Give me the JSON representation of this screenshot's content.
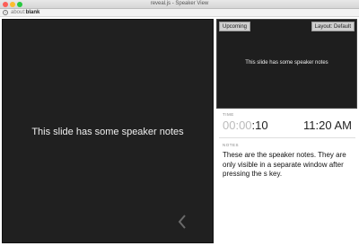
{
  "window": {
    "title": "reveal.js - Speaker View"
  },
  "urlbar": {
    "url_prefix": "about:",
    "url_strong": "blank"
  },
  "current_slide": {
    "text": "This slide has some speaker notes"
  },
  "upcoming": {
    "label": "Upcoming",
    "layout_label": "Layout: Default",
    "text": "This slide has some speaker notes"
  },
  "time": {
    "label": "TIME",
    "elapsed_dim": "00:00",
    "elapsed_main": ":10",
    "clock": "11:20 AM"
  },
  "notes": {
    "label": "NOTES",
    "text": "These are the speaker notes. They are only visible in a separate window after pressing the s key."
  },
  "colors": {
    "slide_bg": "#202020",
    "close": "#fc5f57",
    "minimize": "#fdbc2e",
    "maximize": "#28c840"
  },
  "icons": [
    "info-icon",
    "chevron-left-icon"
  ]
}
